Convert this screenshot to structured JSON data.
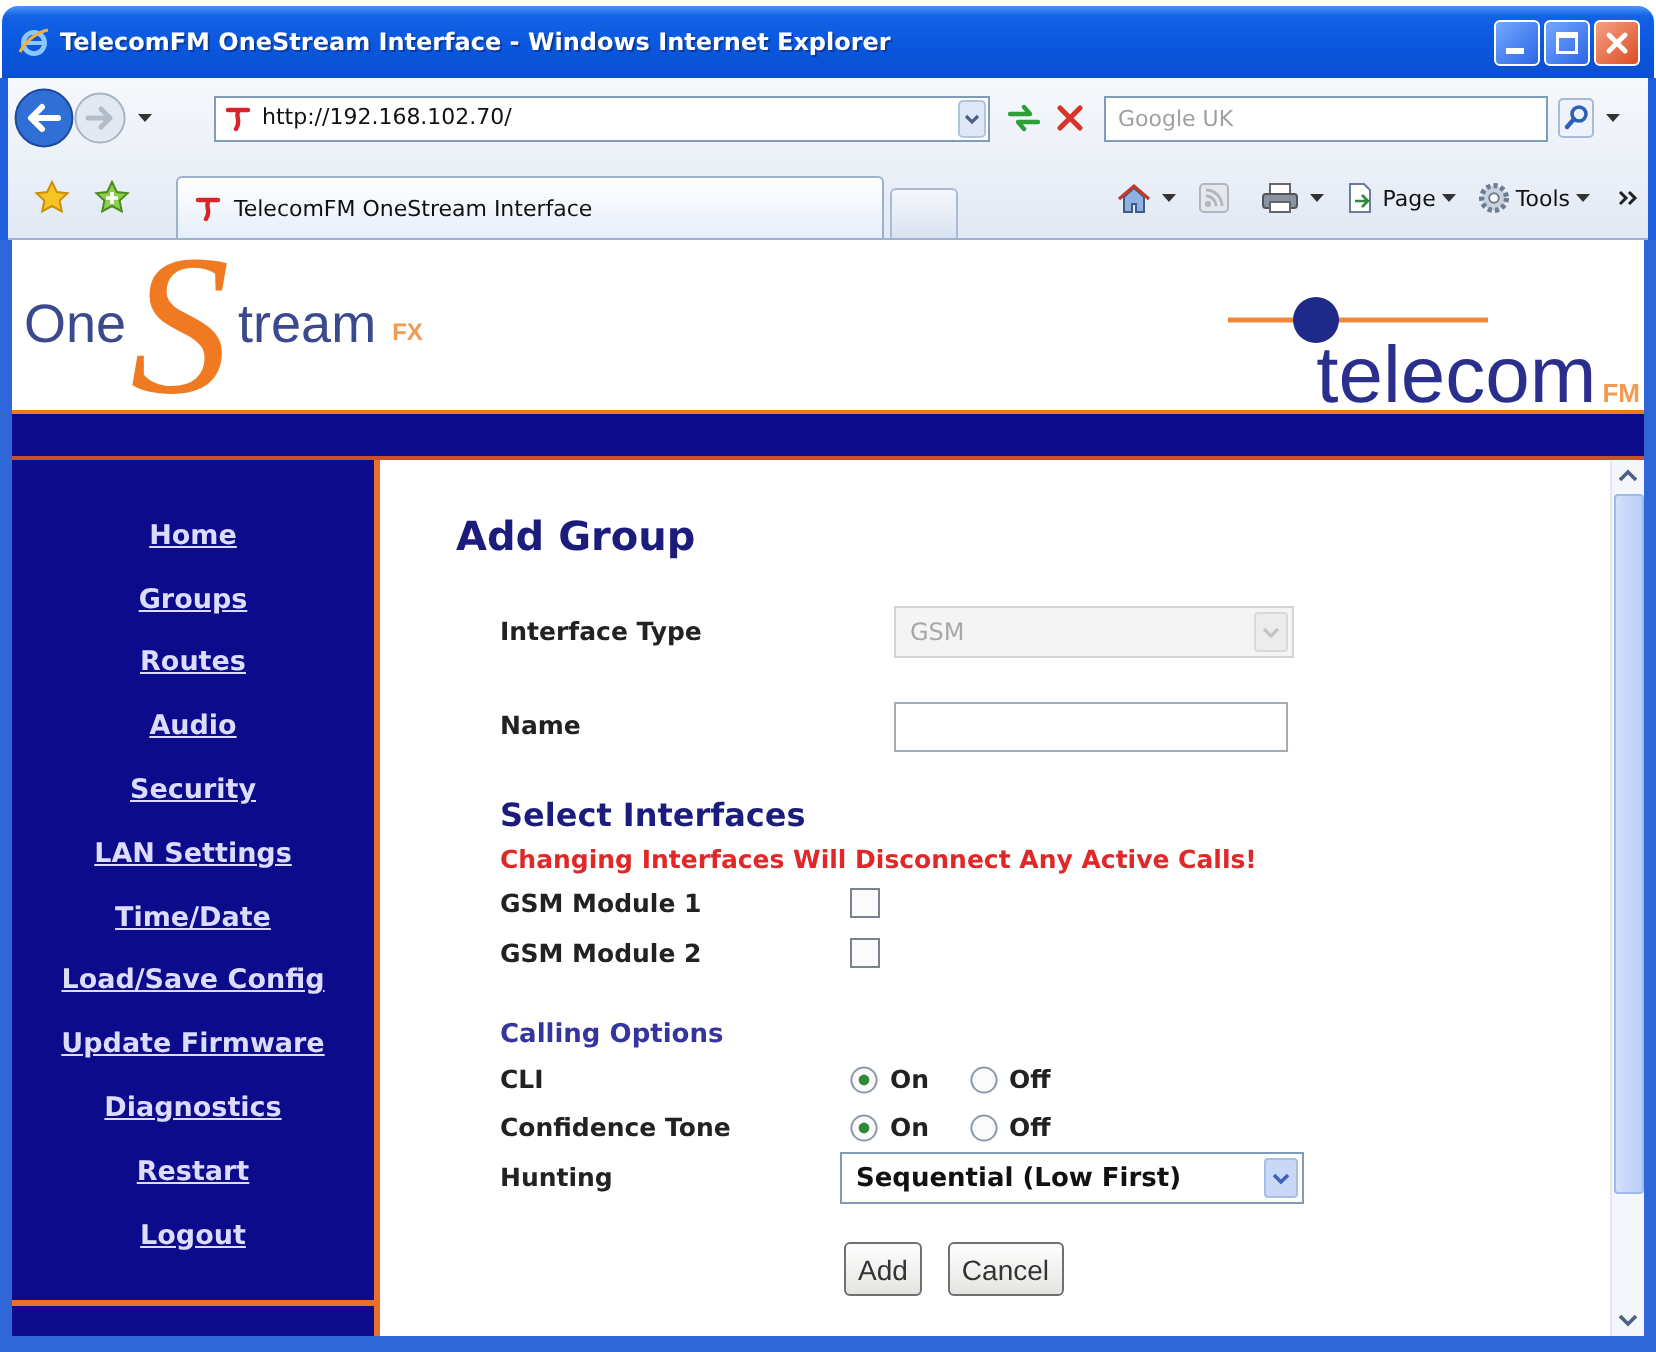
{
  "window": {
    "title": "TelecomFM OneStream Interface - Windows Internet Explorer"
  },
  "nav_buttons": [
    {
      "kind": "back",
      "disabled": false
    },
    {
      "kind": "forward",
      "disabled": true
    }
  ],
  "address_bar": {
    "url": "http://192.168.102.70/"
  },
  "search": {
    "placeholder": "Google UK"
  },
  "tab": {
    "title": "TelecomFM OneStream Interface"
  },
  "command_bar": {
    "menus": [
      {
        "kind": "page",
        "label": "Page"
      },
      {
        "kind": "tools",
        "label": "Tools"
      }
    ]
  },
  "header": {
    "product_logo": {
      "word_1": "One",
      "initial": "S",
      "word_2": "tream",
      "suffix": "FX"
    },
    "company_logo": {
      "name": "telecom",
      "suffix": "FM"
    }
  },
  "sidebar": {
    "items": [
      "Home",
      "Groups",
      "Routes",
      "Audio",
      "Security",
      "LAN Settings",
      "Time/Date",
      "Load/Save Config",
      "Update Firmware",
      "Diagnostics",
      "Restart",
      "Logout"
    ]
  },
  "main": {
    "title": "Add Group",
    "fields": [
      {
        "kind": "select",
        "label": "Interface Type",
        "value": "GSM",
        "disabled": true
      },
      {
        "kind": "text",
        "label": "Name",
        "disabled": false
      }
    ],
    "interfaces": {
      "heading": "Select Interfaces",
      "warning": "Changing Interfaces Will Disconnect Any Active Calls!",
      "modules": [
        {
          "label": "GSM Module 1",
          "checked": false
        },
        {
          "label": "GSM Module 2",
          "checked": false
        }
      ]
    },
    "calling_options": {
      "heading": "Calling Options",
      "rows": [
        {
          "kind": "radio",
          "label": "CLI",
          "choices": [
            {
              "label": "On",
              "selected": true
            },
            {
              "label": "Off",
              "selected": false
            }
          ]
        },
        {
          "kind": "radio",
          "label": "Confidence Tone",
          "choices": [
            {
              "label": "On",
              "selected": true
            },
            {
              "label": "Off",
              "selected": false
            }
          ]
        },
        {
          "kind": "select",
          "label": "Hunting",
          "value": "Sequential (Low First)",
          "disabled": false
        }
      ]
    },
    "buttons": [
      "Add",
      "Cancel"
    ]
  }
}
